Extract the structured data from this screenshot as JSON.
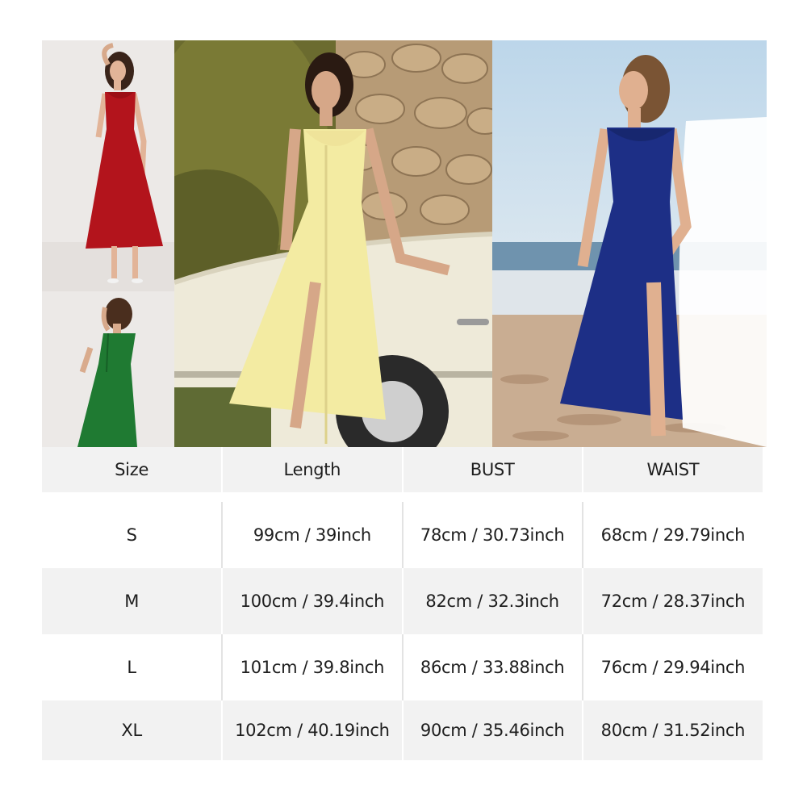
{
  "photos": [
    {
      "name": "red dress model",
      "color": "#b3141c"
    },
    {
      "name": "green dress model",
      "color": "#1f7a32"
    },
    {
      "name": "yellow dress model",
      "color": "#f3eba2"
    },
    {
      "name": "blue dress model",
      "color": "#1d2f86"
    }
  ],
  "table": {
    "headers": [
      "Size",
      "Length",
      "BUST",
      "WAIST"
    ],
    "rows": [
      {
        "size": "S",
        "length": "99cm / 39inch",
        "bust": "78cm / 30.73inch",
        "waist": "68cm / 29.79inch"
      },
      {
        "size": "M",
        "length": "100cm / 39.4inch",
        "bust": "82cm / 32.3inch",
        "waist": "72cm / 28.37inch"
      },
      {
        "size": "L",
        "length": "101cm / 39.8inch",
        "bust": "86cm / 33.88inch",
        "waist": "76cm / 29.94inch"
      },
      {
        "size": "XL",
        "length": "102cm / 40.19inch",
        "bust": "90cm / 35.46inch",
        "waist": "80cm / 31.52inch"
      }
    ]
  }
}
